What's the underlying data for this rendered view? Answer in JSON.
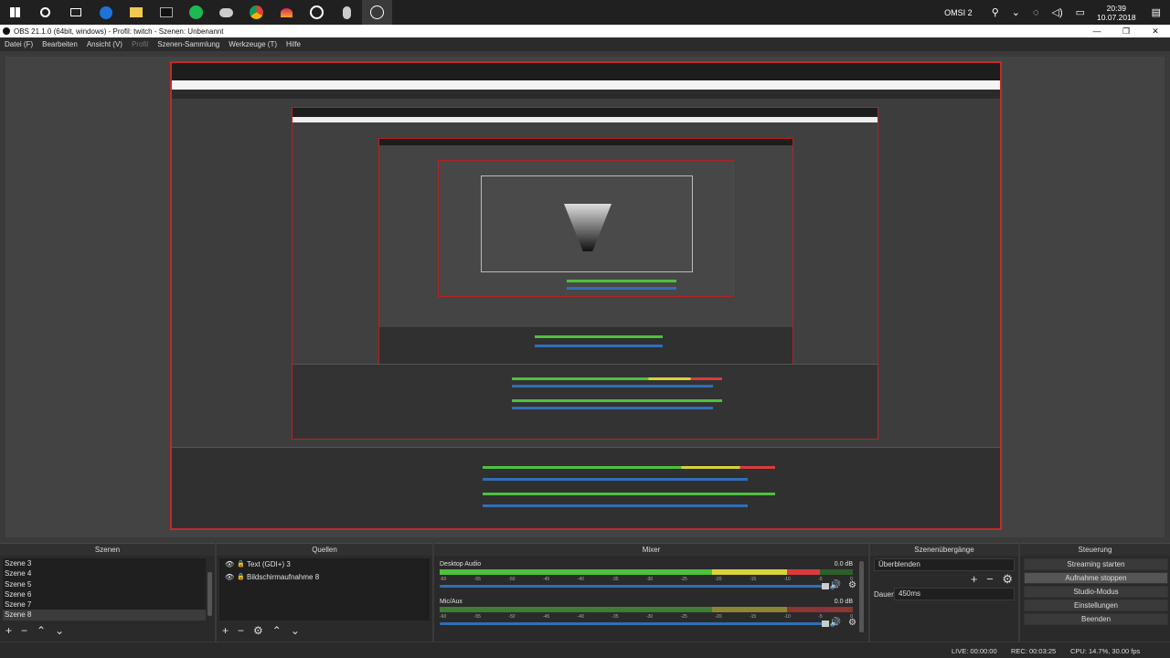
{
  "taskbar": {
    "icons": [
      "windows-start-icon",
      "cortana-circle-icon",
      "task-view-icon",
      "edge-browser-icon",
      "file-explorer-icon",
      "terminal-icon",
      "spotify-icon",
      "cloud-app-icon",
      "chrome-icon",
      "game-app-icon",
      "obs-icon",
      "mouse-icon",
      "obs-record-icon"
    ],
    "tray_label": "OMSI 2",
    "time": "20:39",
    "date": "10.07.2018"
  },
  "window": {
    "title": "OBS 21.1.0 (64bit, windows) - Profil: twitch - Szenen: Unbenannt"
  },
  "menu": {
    "items": [
      "Datei (F)",
      "Bearbeiten",
      "Ansicht (V)",
      "Profil",
      "Szenen-Sammlung",
      "Werkzeuge (T)",
      "Hilfe"
    ]
  },
  "docks": {
    "scenes_title": "Szenen",
    "sources_title": "Quellen",
    "mixer_title": "Mixer",
    "transitions_title": "Szenenübergänge",
    "controls_title": "Steuerung"
  },
  "scenes": {
    "items": [
      "Szene 3",
      "Szene 4",
      "Szene 5",
      "Szene 6",
      "Szene 7",
      "Szene 8"
    ],
    "selected_index": 5
  },
  "sources": {
    "items": [
      "Text (GDI+) 3",
      "Bildschirmaufnahme 8"
    ]
  },
  "mixer": {
    "channels": [
      {
        "name": "Desktop Audio",
        "db": "0.0 dB",
        "level": 0.92
      },
      {
        "name": "Mic/Aux",
        "db": "0.0 dB",
        "level": 0.0
      }
    ],
    "ticks": [
      "-60",
      "-55",
      "-50",
      "-45",
      "-40",
      "-35",
      "-30",
      "-25",
      "-20",
      "-15",
      "-10",
      "-5",
      "0"
    ]
  },
  "transitions": {
    "selected": "Überblenden",
    "duration_label": "Dauer",
    "duration_value": "450ms"
  },
  "controls": {
    "buttons": [
      "Streaming starten",
      "Aufnahme stoppen",
      "Studio-Modus",
      "Einstellungen",
      "Beenden"
    ],
    "active_index": 1
  },
  "status": {
    "live": "LIVE: 00:00:00",
    "rec": "REC: 00:03:25",
    "cpu": "CPU: 14.7%, 30.00 fps"
  },
  "colors": {
    "meter_green": "#4ec13c",
    "meter_yellow": "#d8d23c",
    "meter_red": "#d83c3c",
    "preview_border": "#c62828",
    "volume_blue": "#2f6fb8"
  }
}
